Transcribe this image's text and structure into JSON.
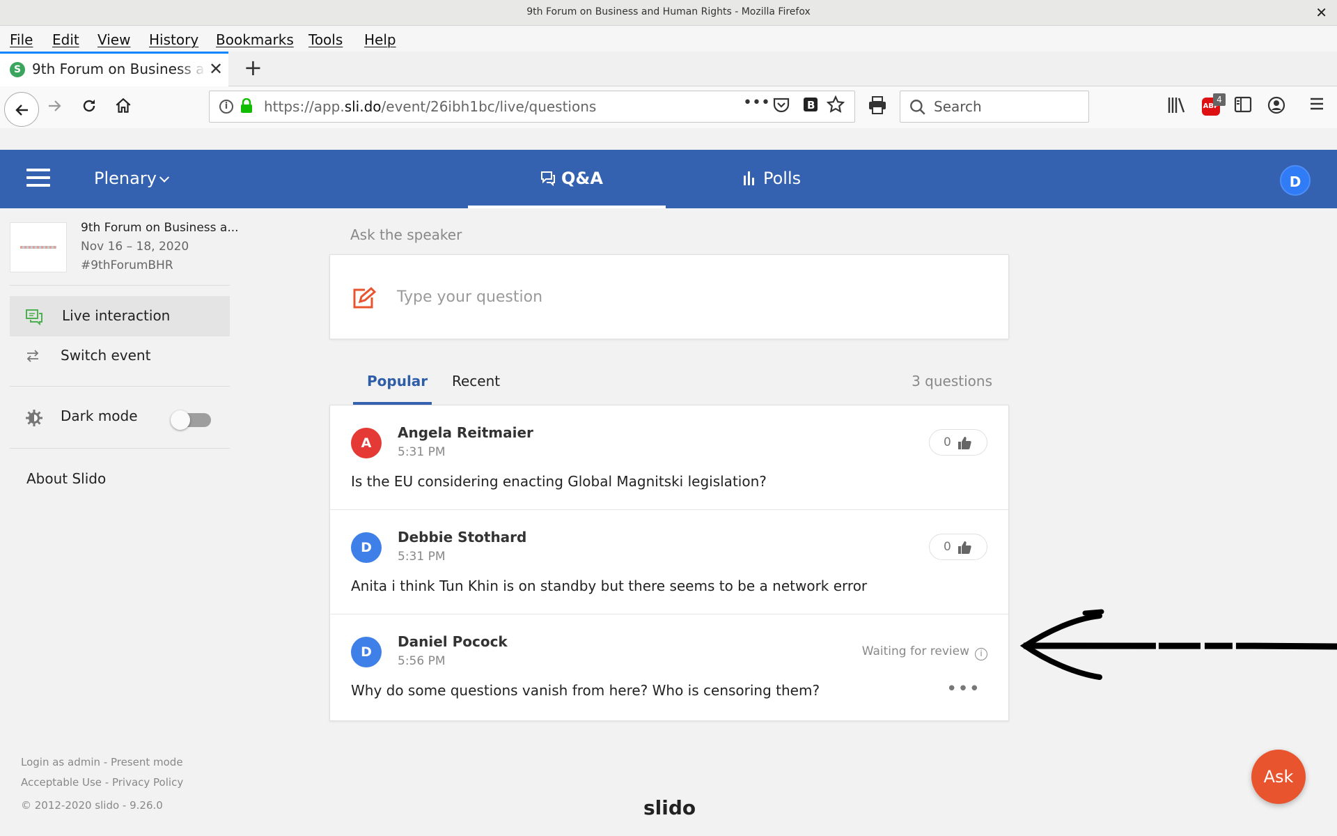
{
  "window": {
    "title": "9th Forum on Business and Human Rights - Mozilla Firefox"
  },
  "menu": [
    "File",
    "Edit",
    "View",
    "History",
    "Bookmarks",
    "Tools",
    "Help"
  ],
  "tab": {
    "title": "9th Forum on Business and Human Rights",
    "favicon_letter": "S"
  },
  "address": {
    "url_prefix": "https://app.",
    "url_domain": "sli.do",
    "url_path": "/event/26ibh1bc/live/questions"
  },
  "search": {
    "placeholder": "Search"
  },
  "addons": {
    "abp_label": "ABP",
    "abp_count": "4"
  },
  "header": {
    "room": "Plenary",
    "tab_qa": "Q&A",
    "tab_polls": "Polls",
    "user_initial": "D",
    "accent": "#3562b0"
  },
  "event": {
    "name": "9th Forum on Business a...",
    "date": "Nov 16 – 18, 2020",
    "hashtag": "#9thForumBHR"
  },
  "sidebar": {
    "live_interaction": "Live interaction",
    "switch_event": "Switch event",
    "dark_mode": "Dark mode",
    "dark_mode_on": false,
    "about": "About Slido",
    "footer_line1": "Login as admin - Present mode",
    "footer_line2": "Acceptable Use - Privacy Policy",
    "footer_line3": "© 2012-2020 slido - 9.26.0"
  },
  "ask": {
    "label": "Ask the speaker",
    "placeholder": "Type your question"
  },
  "qtabs": {
    "popular": "Popular",
    "recent": "Recent",
    "count": "3 questions"
  },
  "questions": [
    {
      "initial": "A",
      "avatar_color": "#e53935",
      "author": "Angela Reitmaier",
      "time": "5:31 PM",
      "likes": "0",
      "text": "Is the EU considering enacting Global Magnitski legislation?"
    },
    {
      "initial": "D",
      "avatar_color": "#3f7fe8",
      "author": "Debbie Stothard",
      "time": "5:31 PM",
      "likes": "0",
      "text": "Anita i think Tun Khin is on standby but there seems to be a network error"
    },
    {
      "initial": "D",
      "avatar_color": "#3f7fe8",
      "author": "Daniel Pocock",
      "time": "5:56 PM",
      "status": "Waiting for review",
      "text": "Why do some questions vanish from here? Who is censoring them?"
    }
  ],
  "footer": {
    "brand": "slido"
  },
  "fab": {
    "label": "Ask",
    "color": "#e8542e"
  }
}
